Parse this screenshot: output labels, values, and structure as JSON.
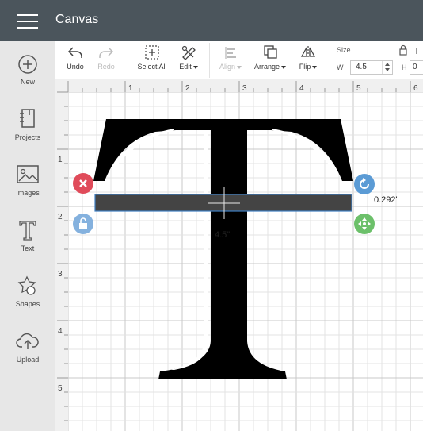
{
  "header": {
    "title": "Canvas"
  },
  "sidebar": {
    "items": [
      {
        "label": "New",
        "icon": "plus-circle-icon"
      },
      {
        "label": "Projects",
        "icon": "notebook-icon"
      },
      {
        "label": "Images",
        "icon": "image-icon"
      },
      {
        "label": "Text",
        "icon": "text-t-icon"
      },
      {
        "label": "Shapes",
        "icon": "shapes-icon"
      },
      {
        "label": "Upload",
        "icon": "cloud-upload-icon"
      }
    ]
  },
  "toolbar": {
    "undo": "Undo",
    "redo": "Redo",
    "select_all": "Select All",
    "edit": "Edit",
    "align": "Align",
    "arrange": "Arrange",
    "flip": "Flip",
    "size": "Size",
    "w_label": "W",
    "w_value": "4.5",
    "h_label": "H",
    "h_value": "0"
  },
  "canvas": {
    "ruler_top": [
      "1",
      "2",
      "3",
      "4",
      "5",
      "6"
    ],
    "ruler_left": [
      "1",
      "2",
      "3",
      "4",
      "5"
    ],
    "selection": {
      "width_label": "4.5\"",
      "height_label": "0.292\""
    },
    "letter_color": "#000000",
    "selection_fill": "#444444",
    "selection_border": "#3f7fc2"
  }
}
